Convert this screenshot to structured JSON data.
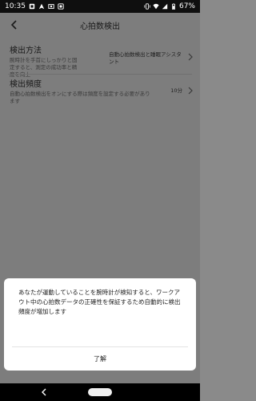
{
  "status_bar": {
    "time": "10:35",
    "battery": "67%"
  },
  "header": {
    "title": "心拍数検出"
  },
  "settings": [
    {
      "title": "検出方法",
      "description": "腕時計を手首にしっかりと固定すると、測定の成功率と精度を向上",
      "value": "自動心拍数検出と睡眠アシスタント"
    },
    {
      "title": "検出頻度",
      "description": "自動心拍数検出をオンにする際は頻度を設定する必要があります",
      "value": "10分"
    }
  ],
  "dialog": {
    "message": "あなたが運動していることを腕時計が検知すると、ワークアウト中の心拍数データの正確性を保証するため自動的に検出頻度が増加します",
    "button": "了解"
  },
  "icons": {
    "back": "back-arrow-icon",
    "chevron": "chevron-right-icon",
    "nav_back": "nav-back-icon",
    "nav_home": "nav-home-pill"
  }
}
